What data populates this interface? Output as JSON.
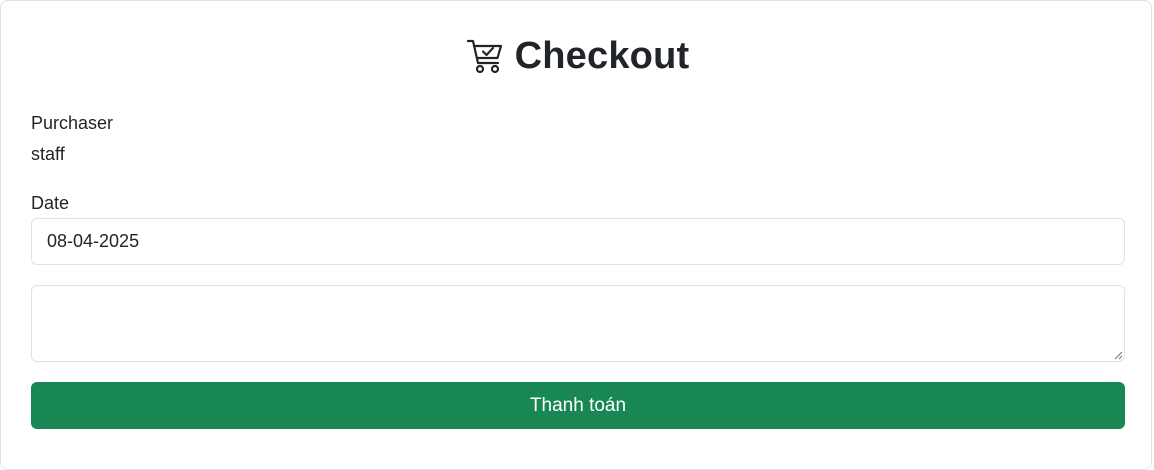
{
  "page": {
    "title": "Checkout",
    "title_icon": "cart-check-icon"
  },
  "form": {
    "purchaser_label": "Purchaser",
    "purchaser_value": "staff",
    "date_label": "Date",
    "date_value": "08-04-2025",
    "note_value": "",
    "submit_label": "Thanh toán"
  },
  "colors": {
    "primary_button": "#198754",
    "border": "#dee2e6",
    "text": "#212529"
  }
}
